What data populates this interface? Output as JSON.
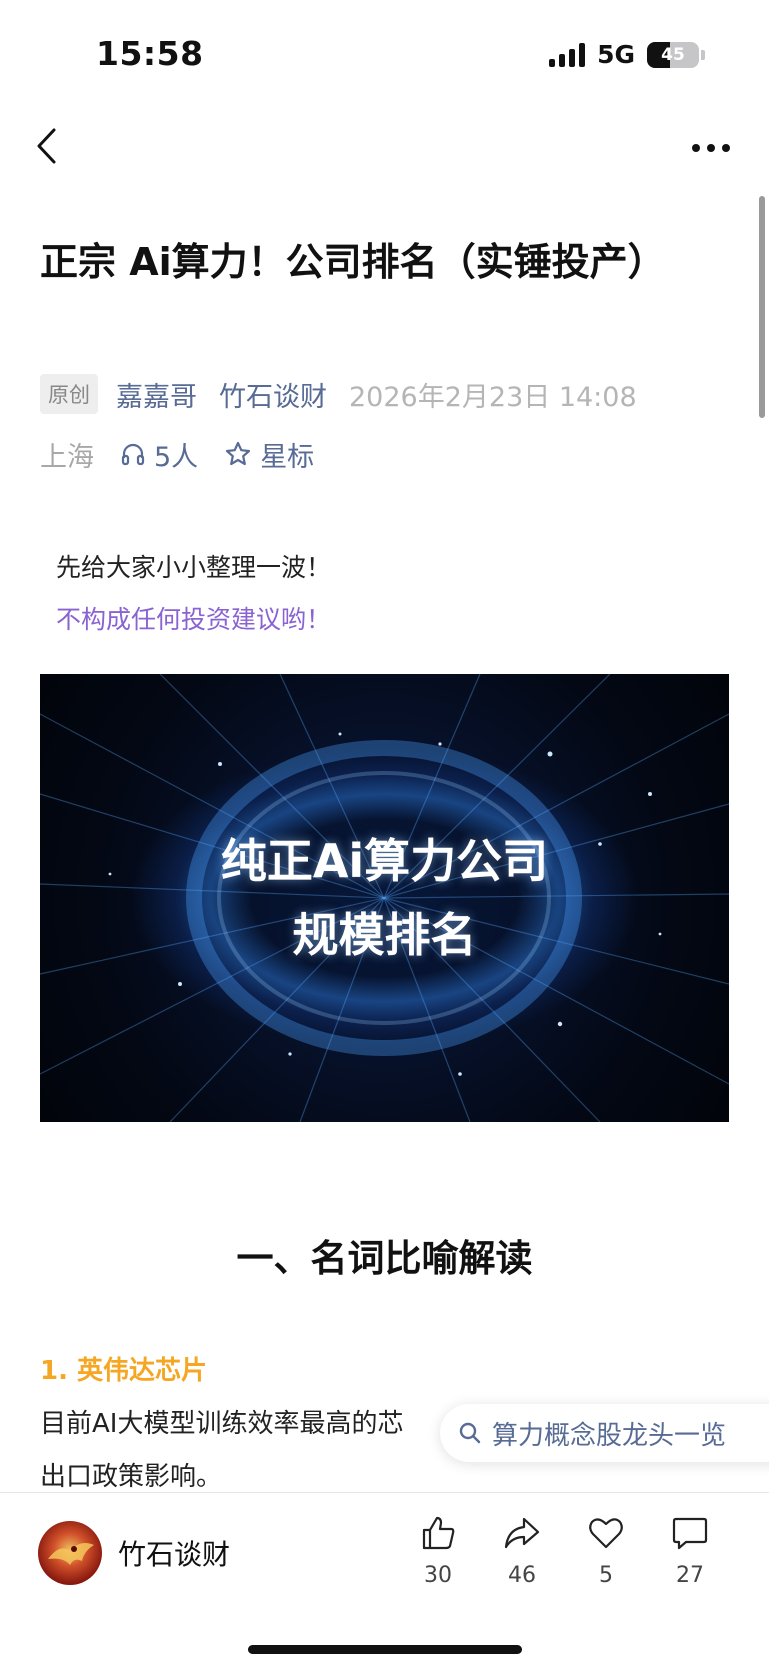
{
  "status_bar": {
    "time": "15:58",
    "network": "5G",
    "battery_level": "45"
  },
  "nav": {
    "back_icon": "chevron-left-icon",
    "more_icon": "ellipsis-icon"
  },
  "article": {
    "title": "正宗 Ai算力！公司排名（实锤投产）",
    "original_tag": "原创",
    "author": "嘉嘉哥",
    "account": "竹石谈财",
    "date": "2026年2月23日 14:08",
    "location": "上海",
    "listeners": "5人",
    "star_label": "星标",
    "intro_line1": "先给大家小小整理一波！",
    "intro_line2": "不构成任何投资建议哟！",
    "cover_text_line1": "纯正Ai算力公司",
    "cover_text_line2": "规模排名",
    "section_heading": "一、名词比喻解读",
    "item1_heading": "1. 英伟达芯片",
    "item1_body_line1": "目前AI大模型训练效率最高的芯",
    "item1_body_line2": "出口政策影响。"
  },
  "floating_search": {
    "label": "算力概念股龙头一览"
  },
  "bottom_bar": {
    "account_name": "竹石谈财",
    "like_count": "30",
    "share_count": "46",
    "favorite_count": "5",
    "comment_count": "27"
  },
  "colors": {
    "link": "#576b95",
    "accent_purple": "#8a63d2",
    "accent_orange": "#f5a623"
  }
}
